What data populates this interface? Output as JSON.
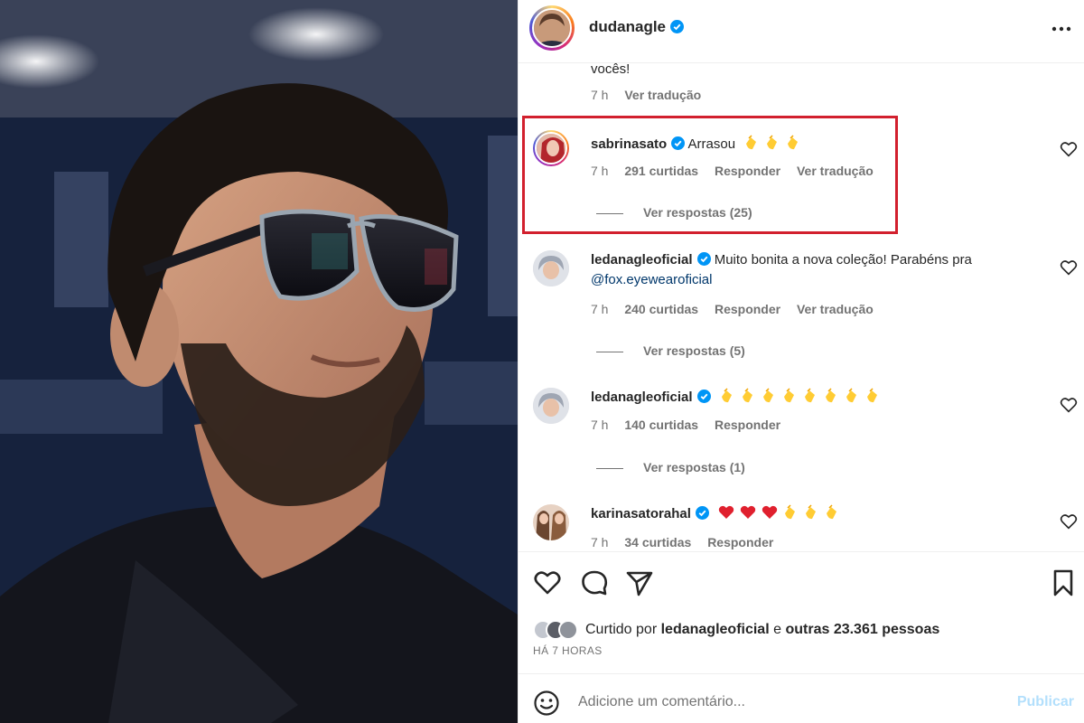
{
  "post": {
    "username": "dudanagle"
  },
  "comments": {
    "partial_text": "vocês!",
    "partial_meta": {
      "time": "7 h",
      "translate": "Ver tradução"
    },
    "items": [
      {
        "username": "sabrinasato",
        "text": "Arrasou",
        "mention": "",
        "emojis": [
          "clap",
          "clap",
          "clap"
        ],
        "time": "7 h",
        "likes": "291 curtidas",
        "reply": "Responder",
        "translate": "Ver tradução",
        "view_replies": "Ver respostas (25)"
      },
      {
        "username": "ledanagleoficial",
        "text": "Muito bonita a nova coleção! Parabéns pra",
        "mention": "@fox.eyewearoficial",
        "emojis": [],
        "time": "7 h",
        "likes": "240 curtidas",
        "reply": "Responder",
        "translate": "Ver tradução",
        "view_replies": "Ver respostas (5)"
      },
      {
        "username": "ledanagleoficial",
        "text": "",
        "mention": "",
        "emojis": [
          "clap",
          "clap",
          "clap",
          "clap",
          "clap",
          "clap",
          "clap",
          "clap"
        ],
        "time": "7 h",
        "likes": "140 curtidas",
        "reply": "Responder",
        "translate": "",
        "view_replies": "Ver respostas (1)"
      },
      {
        "username": "karinasatorahal",
        "text": "",
        "mention": "",
        "emojis": [
          "heart",
          "heart",
          "heart",
          "clap",
          "clap",
          "clap"
        ],
        "time": "7 h",
        "likes": "34 curtidas",
        "reply": "Responder",
        "translate": "",
        "view_replies": ""
      }
    ]
  },
  "likes": {
    "prefix": "Curtido por",
    "user": "ledanagleoficial",
    "connector": "e",
    "others": "outras 23.361 pessoas",
    "timeago": "HÁ 7 HORAS"
  },
  "add_comment": {
    "placeholder": "Adicione um comentário...",
    "publish_label": "Publicar"
  },
  "icons": {
    "verified": "verified-badge-icon",
    "more": "more-options-icon",
    "like": "heart-icon",
    "comment": "comment-bubble-icon",
    "share": "paper-plane-icon",
    "save": "bookmark-icon",
    "emoji": "smiley-icon"
  },
  "colors": {
    "verified_blue": "#0095f6",
    "highlight_box": "#d2202e",
    "publish_disabled": "#b2dffc",
    "muted_text": "#737373"
  }
}
